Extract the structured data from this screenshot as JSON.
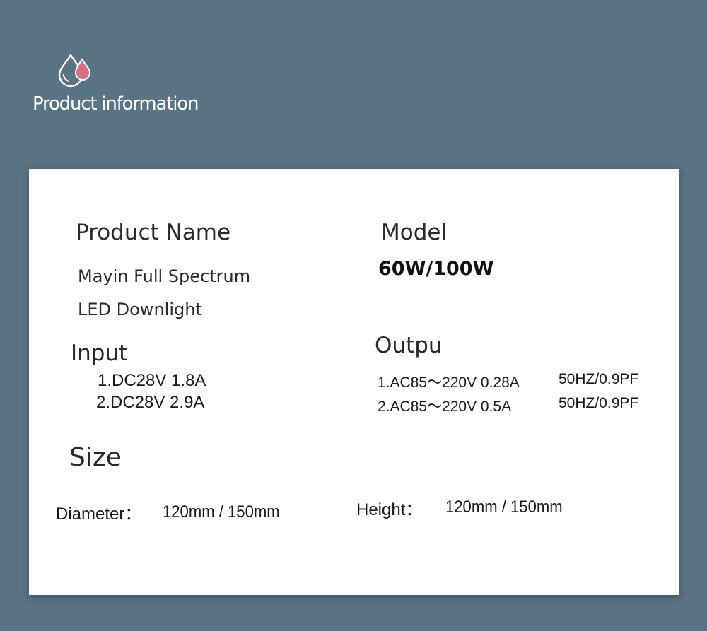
{
  "header": {
    "icon": "water-drops-icon",
    "title": "Product information"
  },
  "colors": {
    "background": "#5a7486",
    "card": "#ffffff",
    "drop_accent": "#d9707f"
  },
  "product_name": {
    "label": "Product Name",
    "line1": "Mayin Full Spectrum",
    "line2": "LED Downlight"
  },
  "model": {
    "label": "Model",
    "value": "60W/100W"
  },
  "input": {
    "label": "Input",
    "items": [
      "1.DC28V 1.8A",
      "2.DC28V 2.9A"
    ]
  },
  "output": {
    "label": "Outpu",
    "items": [
      {
        "spec": "1.AC85～220V 0.28A",
        "freq": "50HZ/0.9PF"
      },
      {
        "spec": "2.AC85～220V 0.5A",
        "freq": "50HZ/0.9PF"
      }
    ]
  },
  "size": {
    "label": "Size",
    "diameter_label": "Diameter：",
    "diameter_value": "120mm / 150mm",
    "height_label": "Height：",
    "height_value": "120mm / 150mm"
  }
}
